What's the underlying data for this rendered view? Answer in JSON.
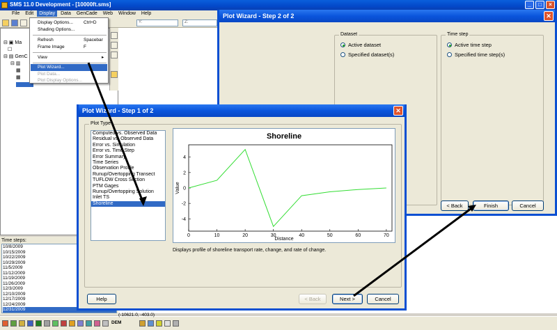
{
  "window": {
    "title": "SMS 11.0 Development - [10000ft.sms]"
  },
  "menubar": [
    "File",
    "Edit",
    "Display",
    "Data",
    "GenCade",
    "Web",
    "Window",
    "Help"
  ],
  "toolbar": {
    "y_label": "Y:",
    "z_label": "Z:"
  },
  "display_menu": {
    "items": [
      {
        "label": "Display Options...",
        "shortcut": "Ctrl+D"
      },
      {
        "label": "Shading Options...",
        "shortcut": ""
      },
      {
        "label": "Refresh",
        "shortcut": "Spacebar"
      },
      {
        "label": "Frame Image",
        "shortcut": "F"
      },
      {
        "label": "View",
        "shortcut": "▸"
      },
      {
        "label": "Plot Wizard...",
        "shortcut": ""
      },
      {
        "label": "Plot Data...",
        "shortcut": ""
      },
      {
        "label": "Plot Display Options...",
        "shortcut": ""
      }
    ]
  },
  "tree": {
    "items": [
      "Ma",
      "GenC"
    ]
  },
  "time_steps": {
    "label": "Time steps:",
    "items": [
      "10/8/2009",
      "10/15/2009",
      "10/22/2009",
      "10/29/2009",
      "11/5/2009",
      "11/12/2009",
      "11/19/2009",
      "11/26/2009",
      "12/3/2009",
      "12/10/2009",
      "12/17/2009",
      "12/24/2009",
      "12/31/2009"
    ],
    "selected": "12/31/2009"
  },
  "status": {
    "coords": "(-10621.0, -403.0)",
    "dem": "DEM"
  },
  "wizard_step2": {
    "title": "Plot Wizard - Step 2 of 2",
    "dataset_group": "Dataset",
    "dataset_options": [
      "Active dataset",
      "Specified dataset(s)"
    ],
    "timestep_group": "Time step",
    "timestep_options": [
      "Active time step",
      "Specified time step(s)"
    ],
    "back": "< Back",
    "finish": "Finish",
    "cancel": "Cancel"
  },
  "wizard_step1": {
    "title": "Plot Wizard - Step 1 of 2",
    "group": "Plot Type",
    "plot_types": [
      "Computed vs. Observed Data",
      "Residual vs. Observed Data",
      "Error vs. Simulation",
      "Error vs. Time Step",
      "Error Summary",
      "Time Series",
      "Observation Profile",
      "Runup/Overtopping Transect",
      "TUFLOW Cross Section",
      "PTM Gages",
      "Runup/Overtopping Solution",
      "Inlet TS",
      "Shoreline"
    ],
    "selected": "Shoreline",
    "description": "Displays profile of shoreline transport rate, change, and rate of change.",
    "help": "Help",
    "back": "< Back",
    "next": "Next >",
    "cancel": "Cancel"
  },
  "chart_data": {
    "type": "line",
    "title": "Shoreline",
    "xlabel": "Distance",
    "ylabel": "Value",
    "x": [
      0,
      10,
      20,
      30,
      40,
      50,
      60,
      70
    ],
    "y": [
      0,
      1,
      5,
      -5,
      -1,
      -0.5,
      -0.2,
      0
    ],
    "xlim": [
      0,
      72
    ],
    "ylim": [
      -5.6,
      5.6
    ],
    "xticks": [
      0,
      10,
      20,
      30,
      40,
      50,
      60,
      70
    ],
    "yticks": [
      -4,
      -2,
      0,
      2,
      4
    ],
    "line_color": "#33dd33",
    "grid": false
  }
}
